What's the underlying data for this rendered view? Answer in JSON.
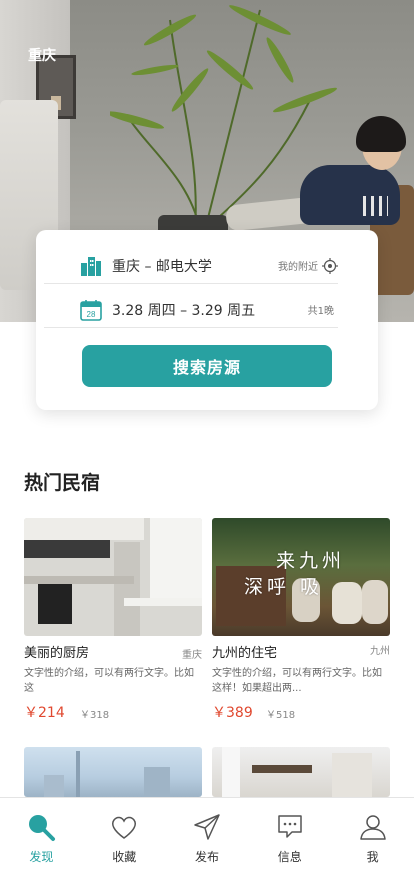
{
  "hero": {
    "location_label": "重庆"
  },
  "search_card": {
    "destination": "重庆 – 邮电大学",
    "nearby_label": "我的附近",
    "dates": "3.28 周四 – 3.29 周五",
    "nights": "共1晚",
    "calendar_day": "28",
    "search_button": "搜索房源"
  },
  "section": {
    "title": "热门民宿"
  },
  "listings": [
    {
      "title": "美丽的厨房",
      "city": "重庆",
      "description": "文字性的介绍，可以有两行文字。比如这",
      "price": "￥214",
      "original_price": "￥318"
    },
    {
      "title": "九州的住宅",
      "city": "九州",
      "description": "文字性的介绍，可以有两行文字。比如这样！如果超出两...",
      "price": "￥389",
      "original_price": "￥518",
      "photo_caption_line1": "来九州",
      "photo_caption_line2": "深呼 吸"
    }
  ],
  "tabbar": {
    "items": [
      {
        "label": "发现",
        "icon": "search-icon",
        "active": true
      },
      {
        "label": "收藏",
        "icon": "heart-icon",
        "active": false
      },
      {
        "label": "发布",
        "icon": "send-icon",
        "active": false
      },
      {
        "label": "信息",
        "icon": "message-icon",
        "active": false
      },
      {
        "label": "我",
        "icon": "user-icon",
        "active": false
      }
    ]
  },
  "colors": {
    "accent": "#28a1a1",
    "price": "#e0482f"
  }
}
